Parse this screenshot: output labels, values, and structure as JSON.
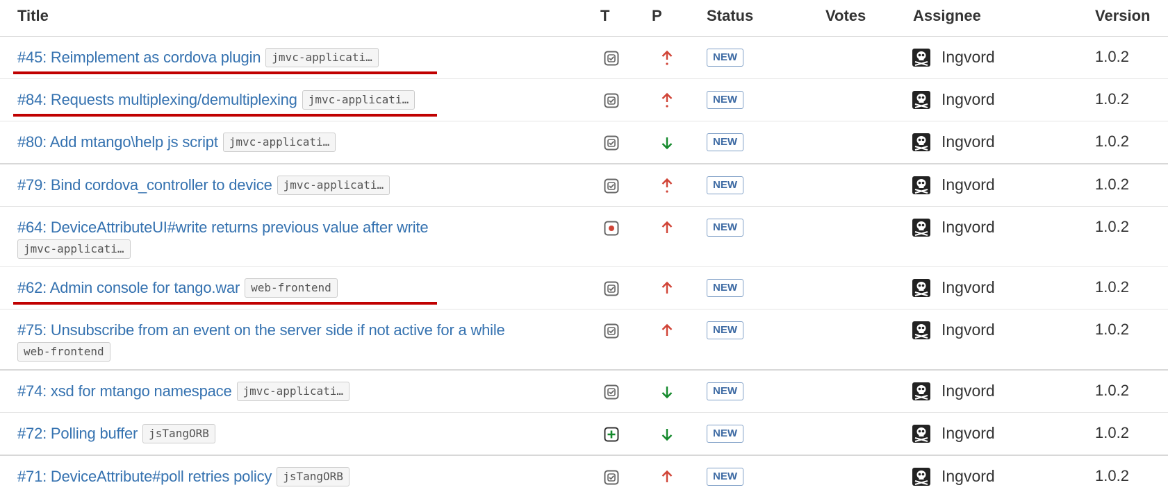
{
  "columns": {
    "title": "Title",
    "type": "T",
    "priority": "P",
    "status": "Status",
    "votes": "Votes",
    "assignee": "Assignee",
    "version": "Version"
  },
  "colors": {
    "link": "#3572b0",
    "priority_up": "#d04437",
    "priority_down": "#14892c",
    "status_new": "#3d6aa3",
    "highlight_underline": "#c00000"
  },
  "rows": [
    {
      "title": "#45: Reimplement as cordova plugin",
      "component": "jmvc-applicati…",
      "type": "task-icon",
      "priority": "major-up-arrow-icon",
      "status": "NEW",
      "votes": "",
      "assignee": "Ingvord",
      "version": "1.0.2",
      "highlighted": true
    },
    {
      "title": "#84: Requests multiplexing/demultiplexing",
      "component": "jmvc-applicati…",
      "type": "task-icon",
      "priority": "major-up-arrow-icon",
      "status": "NEW",
      "votes": "",
      "assignee": "Ingvord",
      "version": "1.0.2",
      "highlighted": true
    },
    {
      "title": "#80: Add mtango\\help js script",
      "component": "jmvc-applicati…",
      "type": "task-icon",
      "priority": "minor-down-arrow-icon",
      "status": "NEW",
      "votes": "",
      "assignee": "Ingvord",
      "version": "1.0.2",
      "highlighted": false
    },
    {
      "title": "#79: Bind cordova_controller to device",
      "component": "jmvc-applicati…",
      "type": "task-icon",
      "priority": "major-up-arrow-icon",
      "status": "NEW",
      "votes": "",
      "assignee": "Ingvord",
      "version": "1.0.2",
      "highlighted": false
    },
    {
      "title": "#64: DeviceAttributeUI#write returns previous value after write",
      "component": "jmvc-applicati…",
      "type": "bug-icon",
      "priority": "up-arrow-icon",
      "status": "NEW",
      "votes": "",
      "assignee": "Ingvord",
      "version": "1.0.2",
      "highlighted": false
    },
    {
      "title": "#62: Admin console for tango.war",
      "component": "web-frontend",
      "type": "task-icon",
      "priority": "up-arrow-icon",
      "status": "NEW",
      "votes": "",
      "assignee": "Ingvord",
      "version": "1.0.2",
      "highlighted": true
    },
    {
      "title": "#75: Unsubscribe from an event on the server side if not active for a while",
      "component": "web-frontend",
      "type": "task-icon",
      "priority": "up-arrow-icon",
      "status": "NEW",
      "votes": "",
      "assignee": "Ingvord",
      "version": "1.0.2",
      "highlighted": false
    },
    {
      "title": "#74: xsd for mtango namespace",
      "component": "jmvc-applicati…",
      "type": "task-icon",
      "priority": "minor-down-arrow-icon",
      "status": "NEW",
      "votes": "",
      "assignee": "Ingvord",
      "version": "1.0.2",
      "highlighted": false
    },
    {
      "title": "#72: Polling buffer",
      "component": "jsTangORB",
      "type": "enhancement-icon",
      "priority": "minor-down-arrow-icon",
      "status": "NEW",
      "votes": "",
      "assignee": "Ingvord",
      "version": "1.0.2",
      "highlighted": false
    },
    {
      "title": "#71: DeviceAttribute#poll retries policy",
      "component": "jsTangORB",
      "type": "task-icon",
      "priority": "up-arrow-icon",
      "status": "NEW",
      "votes": "",
      "assignee": "Ingvord",
      "version": "1.0.2",
      "highlighted": false
    }
  ]
}
